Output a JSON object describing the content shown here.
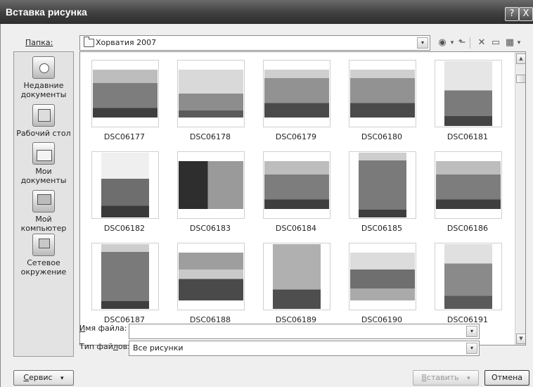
{
  "window": {
    "title": "Вставка рисунка",
    "help_label": "?",
    "close_label": "X"
  },
  "folder": {
    "label": "Папка:",
    "value": "Хорватия 2007"
  },
  "toolbar": {
    "back_glyph": "◉",
    "up_glyph": "⬑",
    "delete_glyph": "✕",
    "newfolder_glyph": "▭",
    "views_glyph": "▦",
    "dropdown_glyph": "▾"
  },
  "places": [
    {
      "label": "Недавние документы",
      "icon": "clock-document-icon"
    },
    {
      "label": "Рабочий стол",
      "icon": "desktop-icon"
    },
    {
      "label": "Мои документы",
      "icon": "documents-folder-icon"
    },
    {
      "label": "Мой компьютер",
      "icon": "computer-icon"
    },
    {
      "label": "Сетевое окружение",
      "icon": "network-icon"
    }
  ],
  "files": [
    {
      "name": "DSC06177",
      "scene": "arena"
    },
    {
      "name": "DSC06178",
      "scene": "tower"
    },
    {
      "name": "DSC06179",
      "scene": "arena-wide"
    },
    {
      "name": "DSC06180",
      "scene": "arena-wide"
    },
    {
      "name": "DSC06181",
      "scene": "tower-portrait"
    },
    {
      "name": "DSC06182",
      "scene": "church-portrait"
    },
    {
      "name": "DSC06183",
      "scene": "arena-tree"
    },
    {
      "name": "DSC06184",
      "scene": "arena"
    },
    {
      "name": "DSC06185",
      "scene": "arena-portrait"
    },
    {
      "name": "DSC06186",
      "scene": "arena"
    },
    {
      "name": "DSC06187",
      "scene": "arena-portrait"
    },
    {
      "name": "DSC06188",
      "scene": "trees-sky"
    },
    {
      "name": "DSC06189",
      "scene": "building-portrait"
    },
    {
      "name": "DSC06190",
      "scene": "street"
    },
    {
      "name": "DSC06191",
      "scene": "street-portrait"
    }
  ],
  "filename": {
    "label_prefix": "",
    "label_underline": "И",
    "label_rest": "мя файла:",
    "value": ""
  },
  "filetype": {
    "label_a": "Тип фай",
    "label_underline": "л",
    "label_b": "ов:",
    "value": "Все рисунки"
  },
  "buttons": {
    "service_underline": "С",
    "service_rest": "ервис",
    "service_dropdown": "▾",
    "insert_underline": "В",
    "insert_rest": "ставить",
    "insert_dropdown": "▾",
    "cancel": "Отмена"
  },
  "scroll": {
    "up": "▲",
    "down": "▼"
  }
}
